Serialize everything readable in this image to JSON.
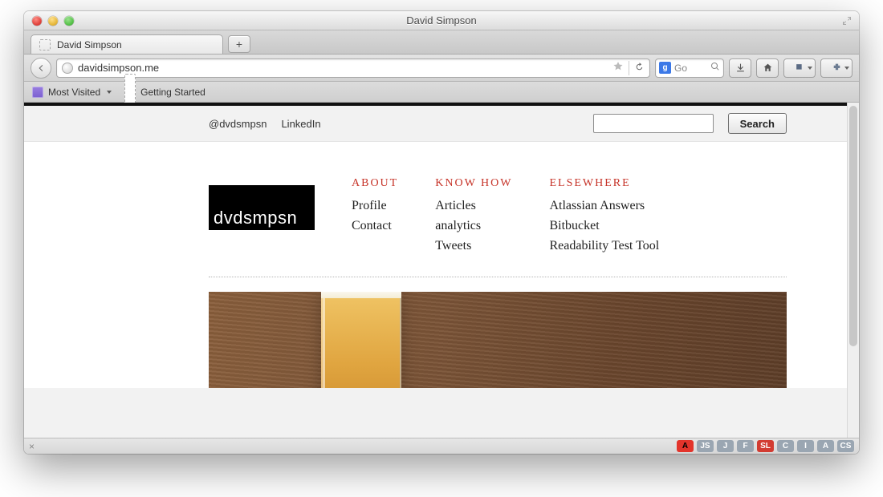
{
  "window": {
    "title": "David Simpson"
  },
  "tabs": [
    {
      "title": "David Simpson"
    }
  ],
  "url": "davidsimpson.me",
  "toolbar": {
    "search_engine_icon": "g",
    "search_hint": "Go"
  },
  "bookmarks": [
    {
      "label": "Most Visited",
      "type": "folder"
    },
    {
      "label": "Getting Started",
      "type": "page"
    }
  ],
  "site": {
    "utility": [
      "@dvdsmpsn",
      "LinkedIn"
    ],
    "search_label": "Search",
    "logo": "dvdsmpsn",
    "columns": [
      {
        "heading": "ABOUT",
        "items": [
          "Profile",
          "Contact"
        ]
      },
      {
        "heading": "KNOW HOW",
        "items": [
          "Articles",
          "analytics",
          "Tweets"
        ]
      },
      {
        "heading": "ELSEWHERE",
        "items": [
          "Atlassian Answers",
          "Bitbucket",
          "Readability Test Tool"
        ]
      }
    ]
  },
  "status": {
    "left_glyph": "×",
    "badges": [
      "A",
      "JS",
      "J",
      "F",
      "SL",
      "C",
      "I",
      "A",
      "CS"
    ]
  }
}
